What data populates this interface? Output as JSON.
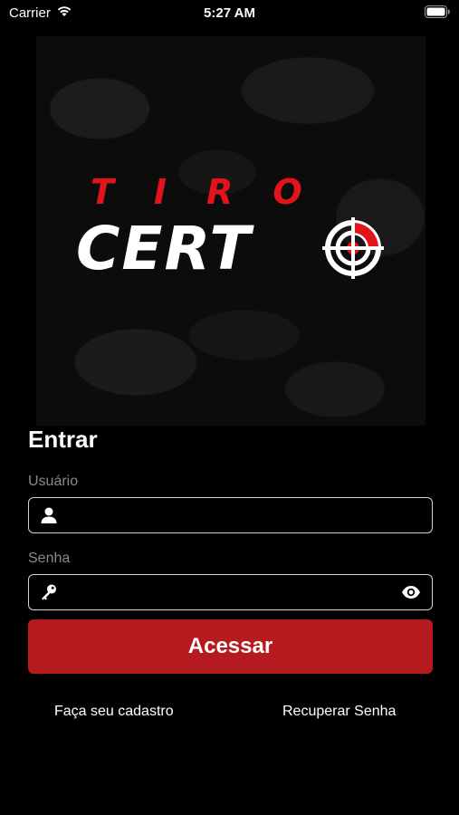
{
  "status_bar": {
    "carrier": "Carrier",
    "time": "5:27 AM",
    "icons": [
      "wifi-icon",
      "battery-icon"
    ]
  },
  "logo": {
    "line1": "TIRO",
    "line2": "CERT",
    "accent_color": "#e1131b",
    "target_icon": "crosshair-target-icon"
  },
  "login": {
    "title": "Entrar",
    "username": {
      "label": "Usuário",
      "value": "",
      "placeholder": "",
      "icon": "user-icon"
    },
    "password": {
      "label": "Senha",
      "value": "",
      "placeholder": "",
      "icon": "key-icon",
      "toggle_icon": "eye-icon"
    },
    "submit_label": "Acessar",
    "submit_color": "#b51b1e",
    "signup_link": "Faça seu cadastro",
    "recover_link": "Recuperar Senha"
  }
}
